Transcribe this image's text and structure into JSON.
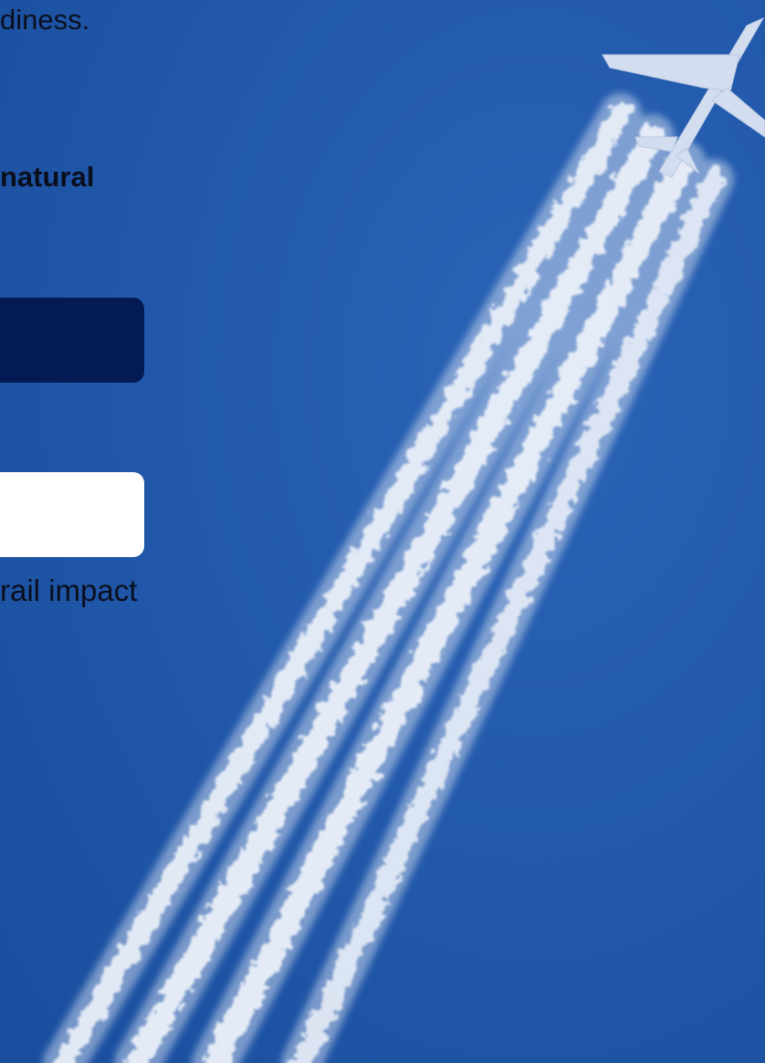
{
  "text": {
    "line1": "diness.",
    "line2": "natural",
    "line3": "rail impact"
  },
  "colors": {
    "sky": "#1e56a9",
    "dark_box": "#031a55",
    "white_box": "#ffffff",
    "contrail": "#f2f6fc"
  },
  "image": {
    "subject": "airplane-with-contrails"
  }
}
